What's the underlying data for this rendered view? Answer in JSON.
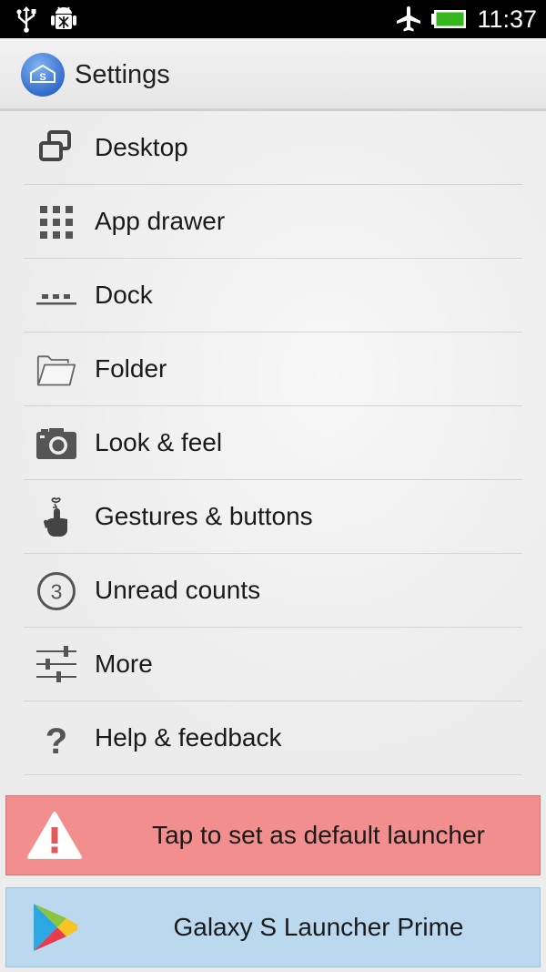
{
  "status_bar": {
    "time": "11:37",
    "icons": [
      "usb-icon",
      "android-debug-icon",
      "airplane-mode-icon",
      "battery-icon"
    ]
  },
  "action_bar": {
    "title": "Settings",
    "app_icon": "launcher-s-icon",
    "app_icon_letter": "S"
  },
  "menu": {
    "items": [
      {
        "label": "Desktop",
        "icon": "desktop-icon"
      },
      {
        "label": "App drawer",
        "icon": "app-drawer-icon"
      },
      {
        "label": "Dock",
        "icon": "dock-icon"
      },
      {
        "label": "Folder",
        "icon": "folder-icon"
      },
      {
        "label": "Look & feel",
        "icon": "camera-icon"
      },
      {
        "label": "Gestures & buttons",
        "icon": "gesture-finger-icon"
      },
      {
        "label": "Unread counts",
        "icon": "unread-count-icon",
        "icon_text": "3"
      },
      {
        "label": "More",
        "icon": "sliders-icon"
      },
      {
        "label": "Help & feedback",
        "icon": "help-icon",
        "icon_text": "?"
      }
    ]
  },
  "banners": {
    "default_launcher": {
      "label": "Tap to set as default launcher",
      "icon": "warning-icon",
      "color": "#f28e8e"
    },
    "prime": {
      "label": "Galaxy S Launcher Prime",
      "icon": "play-store-icon",
      "color": "#bad8ee"
    }
  },
  "colors": {
    "status_bar": "#000000",
    "warning_banner": "#f28e8e",
    "promo_banner": "#bad8ee",
    "app_icon": "#3d7bd6"
  }
}
